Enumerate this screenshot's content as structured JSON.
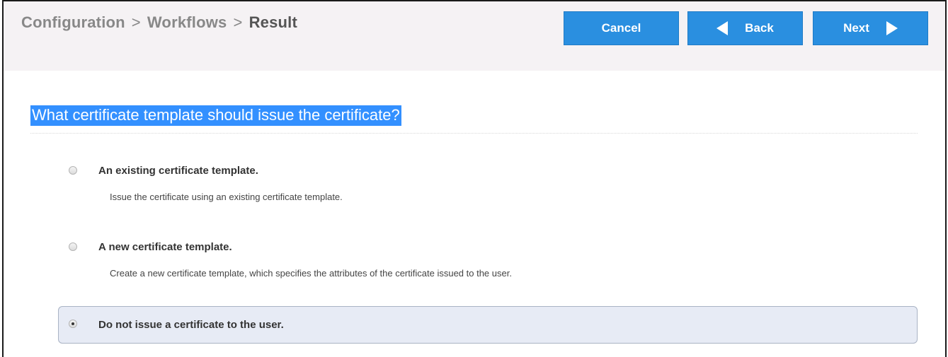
{
  "breadcrumb": {
    "items": [
      "Configuration",
      "Workflows"
    ],
    "separator": ">",
    "current": "Result"
  },
  "buttons": {
    "cancel": "Cancel",
    "back": "Back",
    "next": "Next"
  },
  "question": "What certificate template should issue the certificate?",
  "options": [
    {
      "title": "An existing certificate template.",
      "description": "Issue the certificate using an existing certificate template.",
      "selected": false
    },
    {
      "title": "A new certificate template.",
      "description": "Create a new certificate template, which specifies the attributes of the certificate issued to the user.",
      "selected": false
    },
    {
      "title": "Do not issue a certificate to the user.",
      "selected": true
    }
  ],
  "colors": {
    "button": "#2a8fe0",
    "selection_highlight": "#3390ff",
    "selected_option_bg": "#e7ebf5",
    "header_bg": "#f5f2f4"
  }
}
